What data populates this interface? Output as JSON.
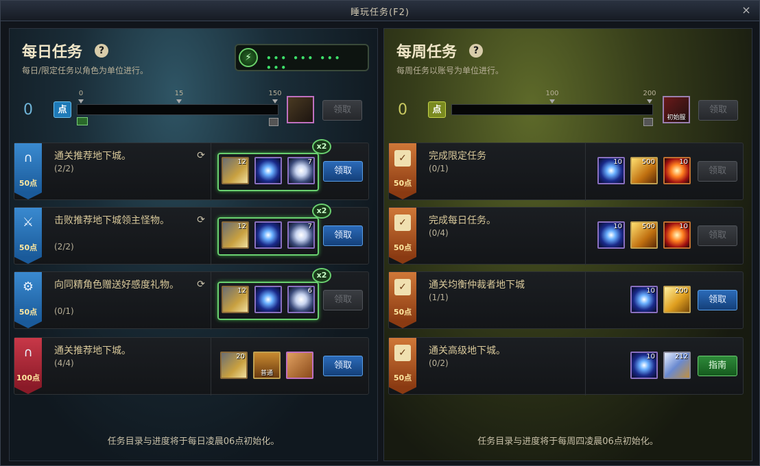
{
  "window": {
    "title": "睡玩任务(F2)",
    "close_glyph": "×"
  },
  "daily": {
    "title": "每日任务",
    "help_glyph": "?",
    "subtitle": "每日/限定任务以角色为单位进行。",
    "fatigue_dots": "••• ••• ••• •••",
    "fatigue_icon": "battery-icon",
    "points": "0",
    "points_badge": "点",
    "ticks": [
      "0",
      "15",
      "150"
    ],
    "claim_label": "领取",
    "footer": "任务目录与进度将于每日凌晨06点初始化。",
    "tasks": [
      {
        "name": "通关推荐地下城。",
        "progress": "(2/2)",
        "points": "50点",
        "flag_color": "blue",
        "icon": "archway-icon",
        "boost": "x2",
        "items": [
          {
            "type": "scroll",
            "count": "12"
          },
          {
            "type": "orb",
            "count": ""
          },
          {
            "type": "pearl",
            "count": "7"
          }
        ],
        "button": "领取",
        "button_state": "active"
      },
      {
        "name": "击败推荐地下城领主怪物。",
        "progress": "(2/2)",
        "points": "50点",
        "flag_color": "blue",
        "icon": "sword-icon",
        "boost": "x2",
        "items": [
          {
            "type": "scroll",
            "count": "12"
          },
          {
            "type": "orb",
            "count": ""
          },
          {
            "type": "pearl",
            "count": "7"
          }
        ],
        "button": "领取",
        "button_state": "active"
      },
      {
        "name": "向同精角色赠送好感度礼物。",
        "progress": "(0/1)",
        "points": "50点",
        "flag_color": "blue",
        "icon": "gift-icon",
        "boost": "x2",
        "items": [
          {
            "type": "scroll",
            "count": "12"
          },
          {
            "type": "orb",
            "count": ""
          },
          {
            "type": "pearl",
            "count": "6"
          }
        ],
        "button": "领取",
        "button_state": "disabled"
      },
      {
        "name": "通关推荐地下城。",
        "progress": "(4/4)",
        "points": "100点",
        "flag_color": "red",
        "icon": "archway-icon",
        "boost": "",
        "items": [
          {
            "type": "scroll",
            "count": "20"
          },
          {
            "type": "chest",
            "count": "",
            "sub": "普通"
          },
          {
            "type": "box",
            "count": ""
          }
        ],
        "button": "领取",
        "button_state": "active"
      }
    ]
  },
  "weekly": {
    "title": "每周任务",
    "help_glyph": "?",
    "subtitle": "每周任务以账号为单位进行。",
    "points": "0",
    "points_badge": "点",
    "ticks": [
      "100",
      "200"
    ],
    "claim_label": "领取",
    "reward_label": "初始服",
    "footer": "任务目录与进度将于每周四凌晨06点初始化。",
    "tasks": [
      {
        "name": "完成限定任务",
        "progress": "(0/1)",
        "points": "50点",
        "icon": "calendar-icon",
        "items": [
          {
            "type": "orb",
            "count": "10"
          },
          {
            "type": "gold",
            "count": "500"
          },
          {
            "type": "burst",
            "count": "10"
          }
        ],
        "button": "领取",
        "button_state": "disabled"
      },
      {
        "name": "完成每日任务。",
        "progress": "(0/4)",
        "points": "50点",
        "icon": "calendar-icon",
        "items": [
          {
            "type": "orb",
            "count": "10"
          },
          {
            "type": "gold",
            "count": "500"
          },
          {
            "type": "burst",
            "count": "10"
          }
        ],
        "button": "领取",
        "button_state": "disabled"
      },
      {
        "name": "通关均衡仲裁者地下城",
        "progress": "(1/1)",
        "points": "50点",
        "icon": "calendar-icon",
        "items": [
          {
            "type": "orb",
            "count": "10"
          },
          {
            "type": "goldbar",
            "count": "200"
          }
        ],
        "button": "领取",
        "button_state": "active"
      },
      {
        "name": "通关高级地下城。",
        "progress": "(0/2)",
        "points": "50点",
        "icon": "calendar-icon",
        "items": [
          {
            "type": "orb",
            "count": "10"
          },
          {
            "type": "cube",
            "count": "212"
          }
        ],
        "button": "指南",
        "button_state": "guide"
      }
    ]
  }
}
